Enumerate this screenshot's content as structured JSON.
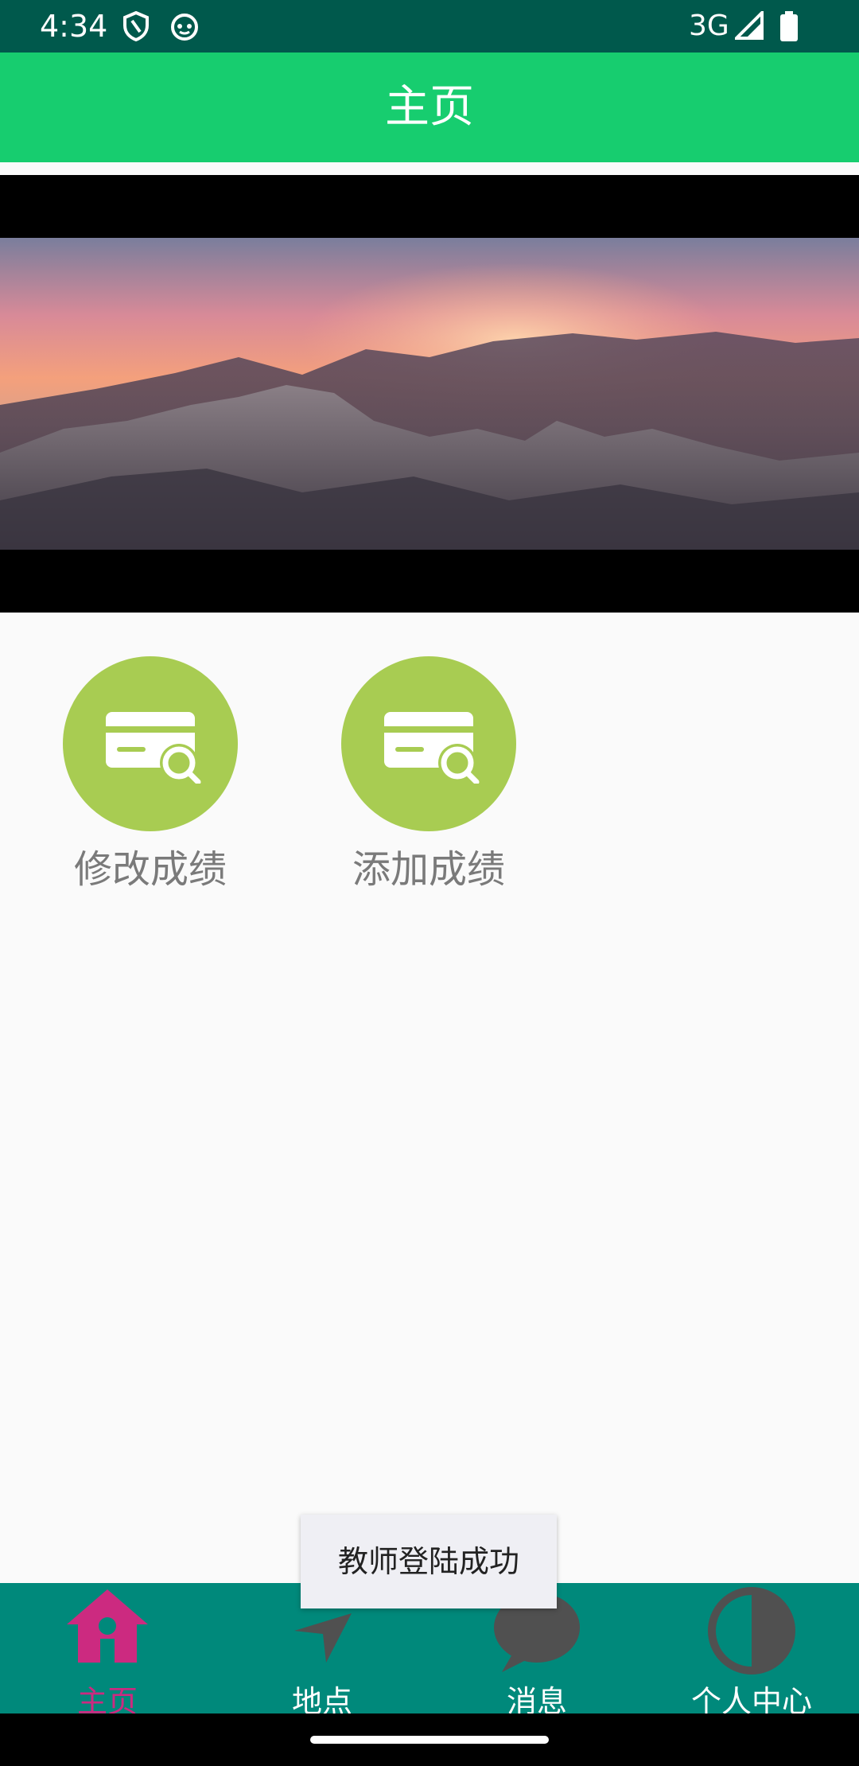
{
  "status_bar": {
    "time": "4:34",
    "network": "3G",
    "icons": [
      "shield-icon",
      "cat-face-icon",
      "signal-icon",
      "battery-icon"
    ]
  },
  "app_bar": {
    "title": "主页"
  },
  "grid": {
    "items": [
      {
        "label": "修改成绩",
        "icon": "card-search-icon"
      },
      {
        "label": "添加成绩",
        "icon": "card-search-icon"
      }
    ]
  },
  "toast": {
    "text": "教师登陆成功"
  },
  "bottom_nav": {
    "items": [
      {
        "label": "主页",
        "icon": "home-icon",
        "active": true
      },
      {
        "label": "地点",
        "icon": "location-arrow-icon",
        "active": false
      },
      {
        "label": "消息",
        "icon": "message-bubble-icon",
        "active": false
      },
      {
        "label": "个人中心",
        "icon": "half-circle-icon",
        "active": false
      }
    ]
  },
  "colors": {
    "status_bar": "#00594c",
    "app_bar": "#17cd6f",
    "tile_circle": "#a8cc52",
    "bottom_nav": "#00897b",
    "active_nav": "#cc2a80",
    "inactive_nav_icon": "#505050"
  }
}
